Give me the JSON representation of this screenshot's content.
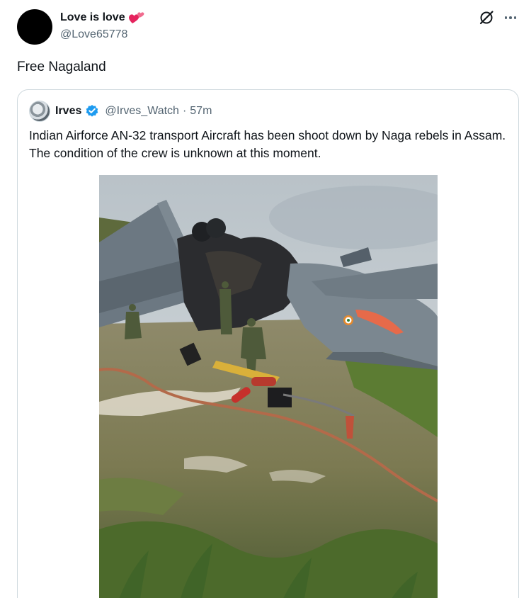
{
  "post": {
    "author_name": "Love is love",
    "author_handle": "@Love65778",
    "text": "Free Nagaland",
    "icons": {
      "heart": "two-hearts-emoji",
      "grok": "grok-icon",
      "more": "more-icon"
    }
  },
  "quote": {
    "author_name": "Irves",
    "author_handle": "@Irves_Watch",
    "separator": "·",
    "time": "57m",
    "text": "Indian Airforce AN-32 transport Aircraft has been shoot down by Naga rebels in Assam. The condition of the crew is unknown at this moment.",
    "verified_color": "#1d9bf0",
    "media": "photo of crashed aircraft wreckage"
  },
  "colors": {
    "text": "#0f1419",
    "muted": "#536471",
    "border": "#cfd9de"
  }
}
